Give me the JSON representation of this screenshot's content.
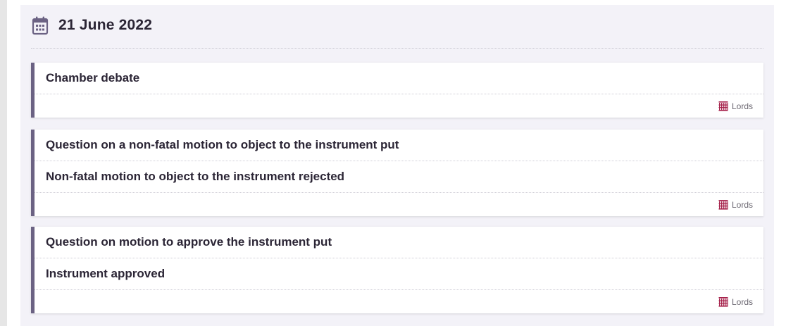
{
  "date_heading": {
    "icon": "calendar-icon",
    "text": "21 June 2022"
  },
  "cards": [
    {
      "items": [
        "Chamber debate"
      ],
      "house": "Lords",
      "house_icon": "portcullis-icon"
    },
    {
      "items": [
        "Question on a non-fatal motion to object to the instrument put",
        "Non-fatal motion to object to the instrument rejected"
      ],
      "house": "Lords",
      "house_icon": "portcullis-icon"
    },
    {
      "items": [
        "Question on motion to approve the instrument put",
        "Instrument approved"
      ],
      "house": "Lords",
      "house_icon": "portcullis-icon"
    }
  ],
  "colors": {
    "accent_border": "#6b6283",
    "lords_red": "#a6224b",
    "panel_bg": "#f3f2f8",
    "heading_text": "#2b2535"
  }
}
